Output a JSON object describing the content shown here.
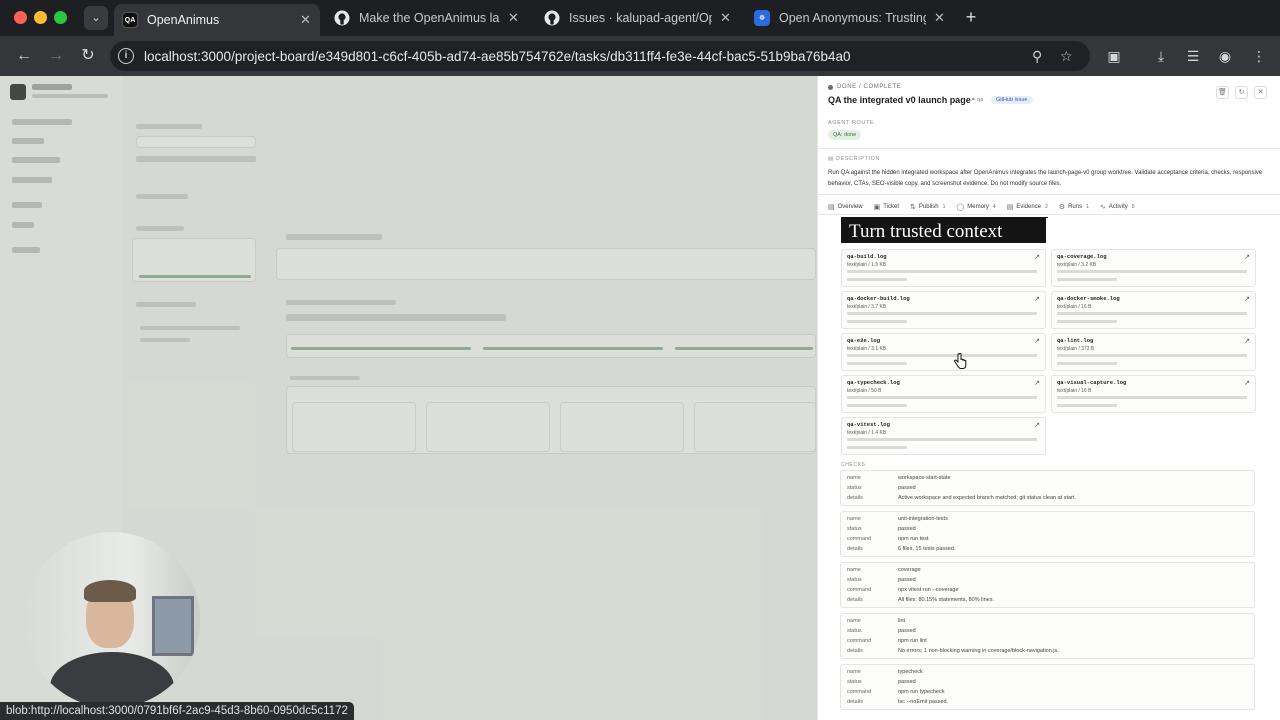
{
  "browser": {
    "tabs": [
      {
        "title": "OpenAnimus",
        "favicon": "QA",
        "active": true
      },
      {
        "title": "Make the OpenAnimus launch",
        "favicon": "github-icon",
        "active": false
      },
      {
        "title": "Issues · kalupad-agent/Open",
        "favicon": "github-icon",
        "active": false
      },
      {
        "title": "Open Anonymous: Trusting A",
        "favicon": "k-icon",
        "active": false
      }
    ],
    "url": "localhost:3000/project-board/e349d801-c6cf-405b-ad74-ae85b754762e/tasks/db311ff4-fe3e-44cf-bac5-51b9ba76b4a0",
    "status_url": "blob:http://localhost:3000/0791bf6f-2ac9-45d3-8b60-0950dc5c1172"
  },
  "drawer": {
    "status": "DONE / COMPLETE",
    "title": "QA the integrated v0 launch page",
    "meta": "qa",
    "badge": "GitHub issue",
    "agent_route_label": "AGENT ROUTE",
    "agent_route_value": "QA: done",
    "description_label": "DESCRIPTION",
    "description": "Run QA against the hidden integrated workspace after OpenAnimus integrates the launch-page-v0 group worktree. Validate acceptance criteria, checks, responsive behavior, CTAs, SEO-visible copy, and screenshot evidence. Do not modify source files.",
    "tabs": [
      {
        "label": "Overview",
        "count": "",
        "icon": "overview-icon"
      },
      {
        "label": "Ticket",
        "count": "",
        "icon": "ticket-icon"
      },
      {
        "label": "Publish",
        "count": "1",
        "icon": "publish-icon"
      },
      {
        "label": "Memory",
        "count": "4",
        "icon": "memory-icon"
      },
      {
        "label": "Evidence",
        "count": "2",
        "icon": "evidence-icon",
        "active": true
      },
      {
        "label": "Runs",
        "count": "1",
        "icon": "runs-icon"
      },
      {
        "label": "Activity",
        "count": "5",
        "icon": "activity-icon"
      }
    ],
    "overlay_text": "Turn trusted context",
    "artifacts": [
      {
        "name": "qa-build.log",
        "meta": "text/plain / 1.5 KB"
      },
      {
        "name": "qa-coverage.log",
        "meta": "text/plain / 3.2 KB"
      },
      {
        "name": "qa-docker-build.log",
        "meta": "text/plain / 3.7 KB"
      },
      {
        "name": "qa-docker-smoke.log",
        "meta": "text/plain / 16 B"
      },
      {
        "name": "qa-e2e.log",
        "meta": "text/plain / 3.1 KB"
      },
      {
        "name": "qa-lint.log",
        "meta": "text/plain / 372 B"
      },
      {
        "name": "qa-typecheck.log",
        "meta": "text/plain / 50 B"
      },
      {
        "name": "qa-visual-capture.log",
        "meta": "text/plain / 16 B"
      },
      {
        "name": "qa-vitest.log",
        "meta": "text/plain / 1.4 KB"
      }
    ],
    "checks_label": "CHECKS",
    "checks": [
      {
        "rows": [
          [
            "name",
            "workspace-start-state"
          ],
          [
            "status",
            "passed"
          ],
          [
            "details",
            "Active workspace and expected branch matched; git status clean at start."
          ]
        ]
      },
      {
        "rows": [
          [
            "name",
            "unit-integration-tests"
          ],
          [
            "status",
            "passed"
          ],
          [
            "command",
            "npm run test"
          ],
          [
            "details",
            "6 files, 15 tests passed."
          ]
        ]
      },
      {
        "rows": [
          [
            "name",
            "coverage"
          ],
          [
            "status",
            "passed"
          ],
          [
            "command",
            "npx vitest run --coverage"
          ],
          [
            "details",
            "All files: 80.15% statements, 80% lines."
          ]
        ]
      },
      {
        "rows": [
          [
            "name",
            "lint"
          ],
          [
            "status",
            "passed"
          ],
          [
            "command",
            "npm run lint"
          ],
          [
            "details",
            "No errors; 1 non-blocking warning in coverage/block-navigation.js."
          ]
        ]
      },
      {
        "rows": [
          [
            "name",
            "typecheck"
          ],
          [
            "status",
            "passed"
          ],
          [
            "command",
            "npm run typecheck"
          ],
          [
            "details",
            "tsc --noEmit passed."
          ]
        ]
      }
    ]
  }
}
